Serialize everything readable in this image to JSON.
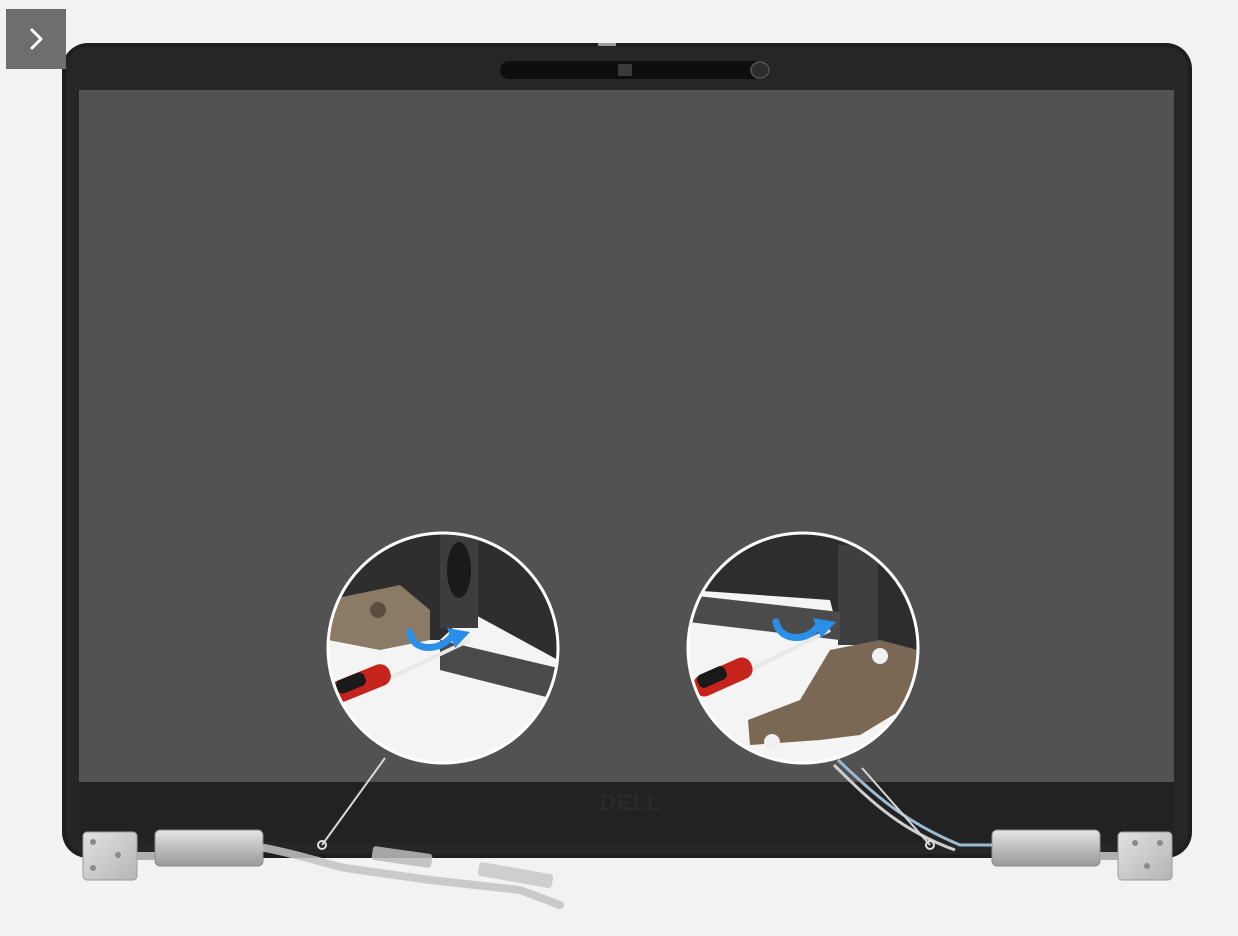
{
  "navigation": {
    "next_button_icon": "chevron-right-icon",
    "button_color": "#6e6e6e"
  },
  "illustration": {
    "brand_logo": "DELL",
    "screen_color": "#525252",
    "bezel_color": "#1e1e1e",
    "arrow_color": "#2b8fe8",
    "callouts": [
      {
        "subject": "left-hinge-pry-detail",
        "icon": "curved-arrow-icon",
        "tool": "screwdriver-icon"
      },
      {
        "subject": "right-hinge-pry-detail",
        "icon": "curved-arrow-icon",
        "tool": "screwdriver-icon"
      }
    ]
  }
}
